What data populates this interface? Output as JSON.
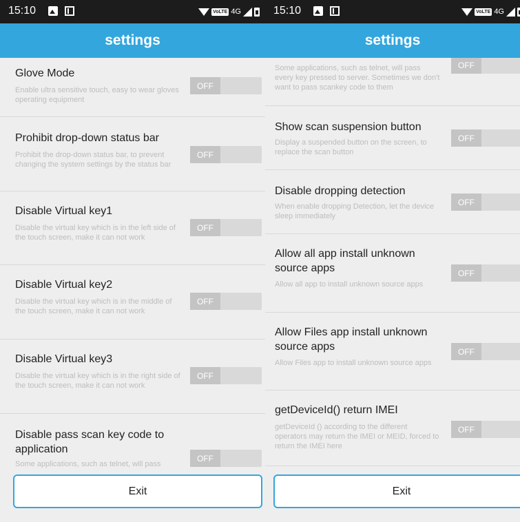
{
  "colors": {
    "accent": "#33a6dd",
    "statusbar": "#1c1c1c",
    "background": "#eeeeee"
  },
  "left": {
    "status": {
      "time": "15:10",
      "network": "4G",
      "volte": "VoLTE"
    },
    "appbar_title": "settings",
    "settings": [
      {
        "title": "Glove Mode",
        "desc": "Enable ultra sensitive touch, easy to wear gloves operating equipment",
        "state": "OFF"
      },
      {
        "title": "Prohibit drop-down status bar",
        "desc": "Prohibit the drop-down status bar, to prevent changing the system settings by the status bar",
        "state": "OFF"
      },
      {
        "title": "Disable Virtual key1",
        "desc": "Disable the virtual key which is in the left side of the touch screen, make it can not work",
        "state": "OFF"
      },
      {
        "title": "Disable Virtual key2",
        "desc": "Disable the virtual key which is in the middle of the touch screen, make it can not work",
        "state": "OFF"
      },
      {
        "title": "Disable Virtual key3",
        "desc": "Disable the virtual key which is in the right side of the touch screen, make it can not work",
        "state": "OFF"
      },
      {
        "title": "Disable pass scan key code to application",
        "desc": "Some applications, such as telnet, will pass",
        "state": "OFF"
      }
    ],
    "exit_label": "Exit"
  },
  "right": {
    "status": {
      "time": "15:10",
      "network": "4G",
      "volte": "VoLTE"
    },
    "appbar_title": "settings",
    "settings": [
      {
        "title": "",
        "desc": "Some applications, such as telnet, will pass every key pressed to server. Sometimes we don't want to pass scankey code to them",
        "state": "OFF"
      },
      {
        "title": "Show scan suspension button",
        "desc": "Display a suspended button on the screen, to replace the scan button",
        "state": "OFF"
      },
      {
        "title": "Disable dropping detection",
        "desc": "When enable dropping Detection, let the device sleep immediately",
        "state": "OFF"
      },
      {
        "title": "Allow all app install unknown source apps",
        "desc": "Allow all app to install unknown source apps",
        "state": "OFF"
      },
      {
        "title": "Allow Files app install unknown source apps",
        "desc": "Allow Files app to install unknown source apps",
        "state": "OFF"
      },
      {
        "title": "getDeviceId() return IMEI",
        "desc": "getDeviceId () according to the different operators may return the IMEI or MEID, forced to return the IMEI here",
        "state": "OFF"
      }
    ],
    "exit_label": "Exit"
  }
}
